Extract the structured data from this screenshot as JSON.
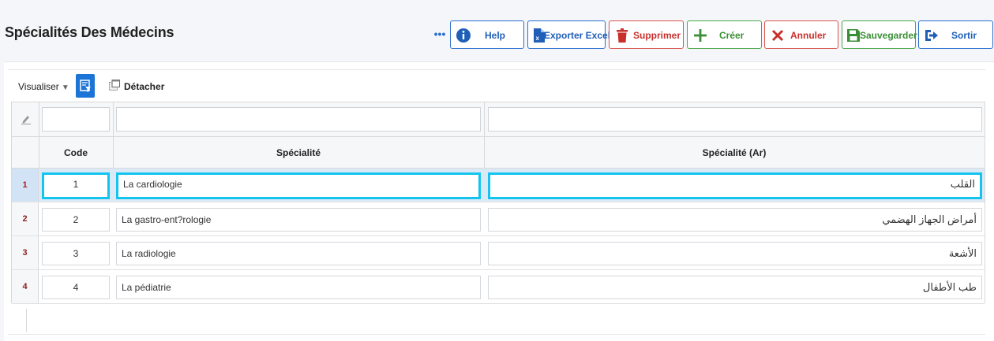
{
  "page": {
    "title": "Spécialités Des Médecins"
  },
  "toolbar": {
    "buttons": [
      {
        "label": "Help",
        "icon": "info-icon"
      },
      {
        "label": "Exporter Excel",
        "icon": "excel-file-icon"
      },
      {
        "label": "Supprimer",
        "icon": "trash-icon"
      },
      {
        "label": "Créer",
        "icon": "plus-icon"
      },
      {
        "label": "Annuler",
        "icon": "close-icon"
      },
      {
        "label": "Sauvegarder",
        "icon": "save-icon"
      },
      {
        "label": "Sortir",
        "icon": "exit-icon"
      }
    ],
    "more": "•••"
  },
  "subbar": {
    "view_label": "Visualiser",
    "detach_label": "Détacher"
  },
  "grid": {
    "columns": [
      "Code",
      "Spécialité",
      "Spécialité (Ar)"
    ],
    "rows": [
      {
        "num": "1",
        "code": "1",
        "specialite": "La cardiologie",
        "specialite_ar": "القلب"
      },
      {
        "num": "2",
        "code": "2",
        "specialite": "La gastro-ent?rologie",
        "specialite_ar": "أمراض الجهاز الهضمي"
      },
      {
        "num": "3",
        "code": "3",
        "specialite": "La radiologie",
        "specialite_ar": "الأشعة"
      },
      {
        "num": "4",
        "code": "4",
        "specialite": "La pédiatrie",
        "specialite_ar": "طب الأطفال"
      }
    ],
    "selected_row": 1
  },
  "colors": {
    "primary": "#1b74d6",
    "danger": "#d9534f",
    "success": "#4aa548",
    "selection": "#12c4ee"
  }
}
